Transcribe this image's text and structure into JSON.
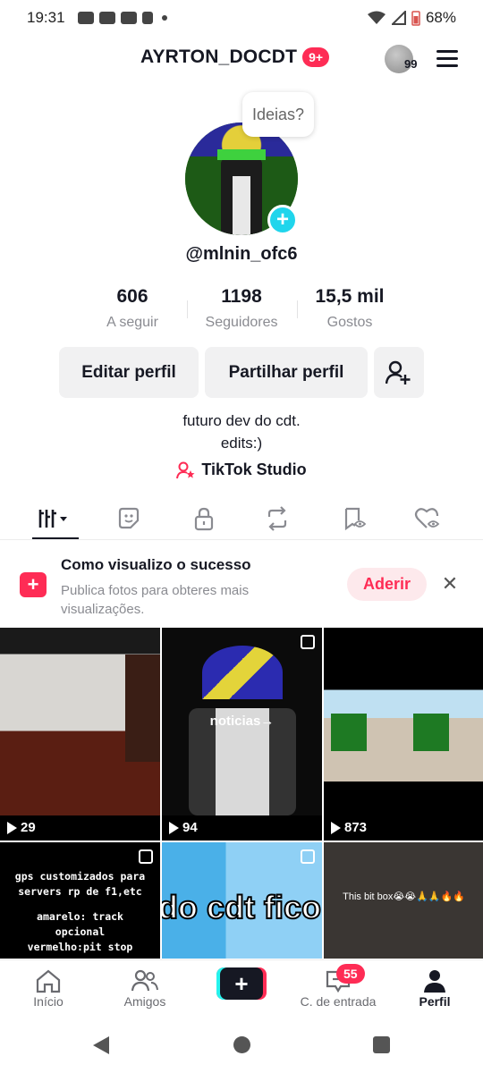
{
  "status_bar": {
    "time": "19:31",
    "battery": "68%"
  },
  "header": {
    "username": "AYRTON_DOCDT",
    "notif_badge": "9+",
    "coins": "99"
  },
  "avatar_bubble": "Ideias?",
  "handle": "@mlnin_ofc6",
  "stats": [
    {
      "value": "606",
      "label": "A seguir"
    },
    {
      "value": "1198",
      "label": "Seguidores"
    },
    {
      "value": "15,5 mil",
      "label": "Gostos"
    }
  ],
  "buttons": {
    "edit": "Editar perfil",
    "share": "Partilhar perfil"
  },
  "bio": {
    "line1": "futuro dev do cdt.",
    "line2": "edits:)"
  },
  "studio_link": "TikTok Studio",
  "banner": {
    "title": "Como visualizo o sucesso",
    "text": "Publica fotos para obteres mais visualizações.",
    "join_label": "Aderir"
  },
  "videos": [
    {
      "views": "29"
    },
    {
      "views": "94",
      "caption": "noticias→"
    },
    {
      "views": "873"
    },
    {
      "line1": "gps customizados para",
      "line2": "servers rp de f1,etc",
      "line3": "amarelo: track",
      "line4": "opcional",
      "line5": "vermelho:pit stop"
    },
    {
      "caption": "do cdt ficou"
    },
    {
      "caption": "This bit box😭😭🙏🙏🔥🔥"
    }
  ],
  "bottom_nav": {
    "home": "Início",
    "friends": "Amigos",
    "inbox": "C. de entrada",
    "inbox_badge": "55",
    "profile": "Perfil"
  },
  "colors": {
    "accent": "#fe2c55",
    "cyan": "#20d5ec",
    "text": "#161823",
    "muted": "#8a8b91"
  }
}
